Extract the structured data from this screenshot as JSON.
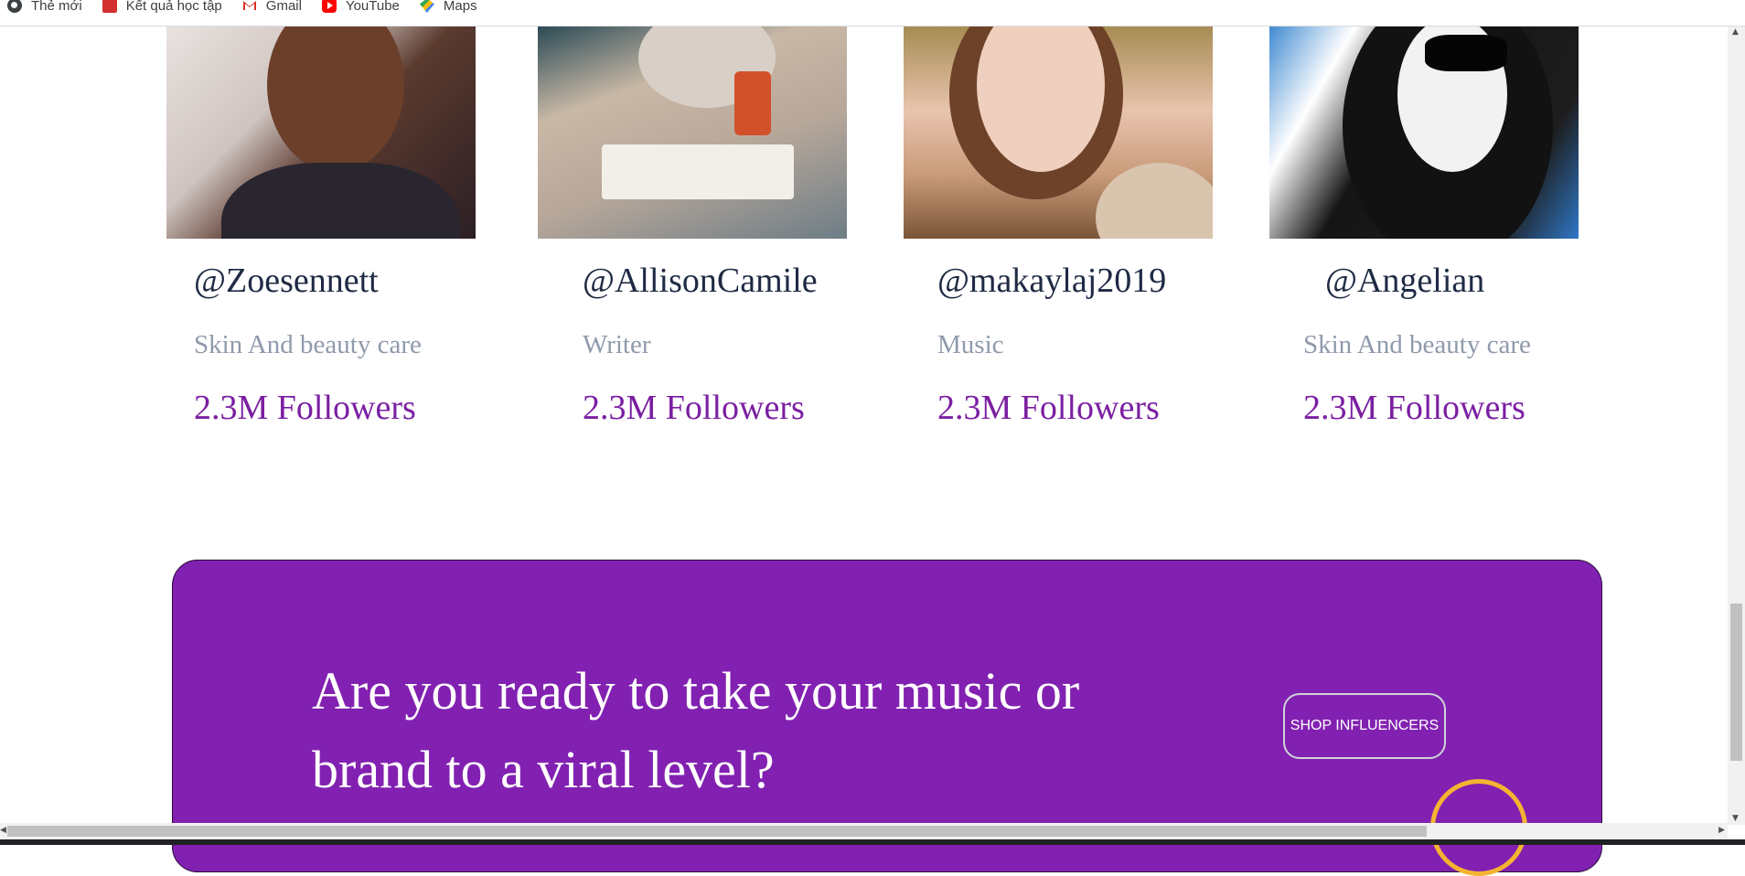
{
  "bookmarks": [
    {
      "label": "Thẻ mới",
      "icon": "globe-icon"
    },
    {
      "label": "Kết quả học tập",
      "icon": "vnu-icon"
    },
    {
      "label": "Gmail",
      "icon": "gmail-icon"
    },
    {
      "label": "YouTube",
      "icon": "youtube-icon"
    },
    {
      "label": "Maps",
      "icon": "maps-icon"
    }
  ],
  "influencers": [
    {
      "handle": "@Zoesennett",
      "category": "Skin And beauty care",
      "followers": "2.3M Followers"
    },
    {
      "handle": "@AllisonCamile",
      "category": "Writer",
      "followers": "2.3M Followers"
    },
    {
      "handle": "@makaylaj2019",
      "category": "Music",
      "followers": "2.3M Followers"
    },
    {
      "handle": "@Angelian",
      "category": "Skin And beauty care",
      "followers": "2.3M Followers"
    }
  ],
  "cta": {
    "headline": "Are you ready to take your music or brand to a viral level?",
    "button_label": "SHOP INFLUENCERS"
  },
  "colors": {
    "accent_purple": "#8221b1",
    "followers_purple": "#7b1fa2",
    "ring_orange": "#f5b331"
  }
}
